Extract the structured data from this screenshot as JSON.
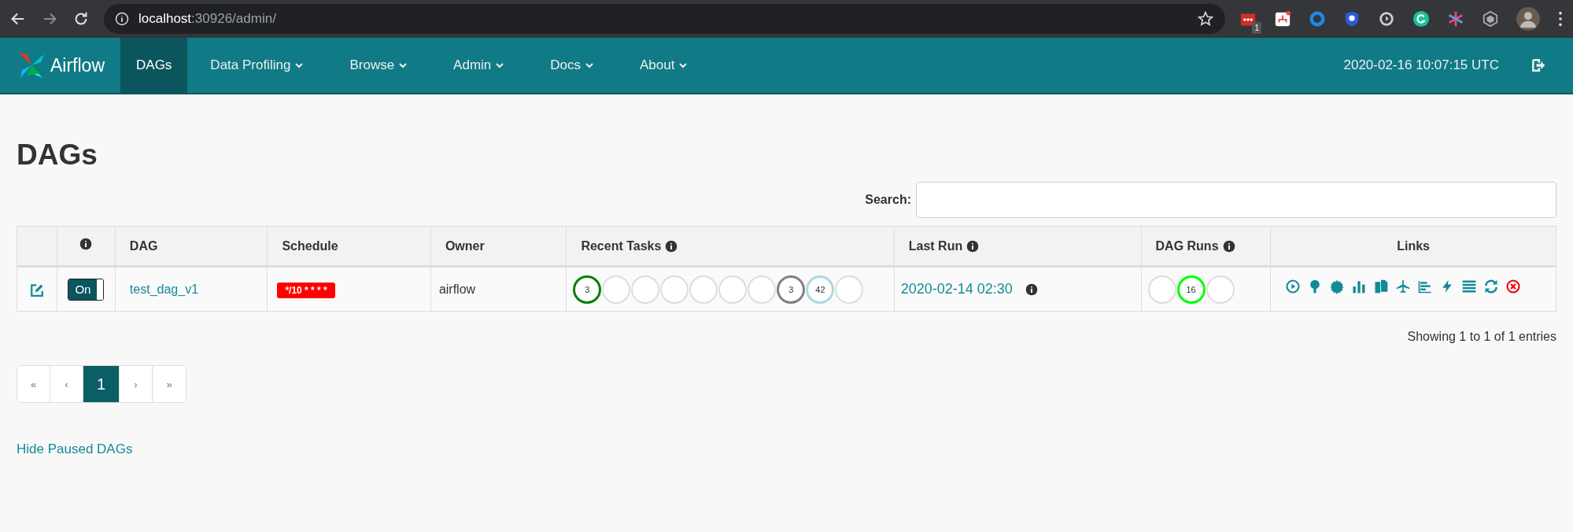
{
  "browser": {
    "url_host": "localhost",
    "url_rest": ":30926/admin/",
    "extension_badge": "1"
  },
  "navbar": {
    "brand": "Airflow",
    "items": [
      {
        "label": "DAGs",
        "selected": true,
        "dropdown": false
      },
      {
        "label": "Data Profiling",
        "selected": false,
        "dropdown": true
      },
      {
        "label": "Browse",
        "selected": false,
        "dropdown": true
      },
      {
        "label": "Admin",
        "selected": false,
        "dropdown": true
      },
      {
        "label": "Docs",
        "selected": false,
        "dropdown": true
      },
      {
        "label": "About",
        "selected": false,
        "dropdown": true
      }
    ],
    "clock": "2020-02-16 10:07:15 UTC"
  },
  "page_title": "DAGs",
  "search": {
    "label": "Search:"
  },
  "table": {
    "columns": [
      {
        "info": false
      },
      {
        "info": true
      },
      {
        "label": "DAG",
        "info": false
      },
      {
        "label": "Schedule",
        "info": false
      },
      {
        "label": "Owner",
        "info": false
      },
      {
        "label": "Recent Tasks",
        "info": true
      },
      {
        "label": "Last Run",
        "info": true
      },
      {
        "label": "DAG Runs",
        "info": true
      },
      {
        "label": "Links",
        "info": false
      }
    ],
    "rows": [
      {
        "toggle": {
          "label": "On",
          "on": true
        },
        "dag": "test_dag_v1",
        "schedule": "*/10 * * * *",
        "owner": "airflow",
        "recent_tasks": [
          {
            "count": "3",
            "color": "#008000"
          },
          {
            "color": "#dddddd"
          },
          {
            "color": "#dddddd"
          },
          {
            "color": "#dddddd"
          },
          {
            "color": "#dddddd"
          },
          {
            "color": "#dddddd"
          },
          {
            "color": "#dddddd"
          },
          {
            "count": "3",
            "color": "#808080"
          },
          {
            "count": "42",
            "color": "#add8e6"
          },
          {
            "color": "#dddddd"
          }
        ],
        "last_run": "2020-02-14 02:30",
        "dag_runs": [
          {
            "color": "#dddddd"
          },
          {
            "count": "16",
            "color": "#00ff00"
          },
          {
            "color": "#dddddd"
          }
        ]
      }
    ]
  },
  "table_info": "Showing 1 to 1 of 1 entries",
  "pagination": [
    {
      "label": "«",
      "selected": false
    },
    {
      "label": "‹",
      "selected": false
    },
    {
      "label": "1",
      "selected": true
    },
    {
      "label": "›",
      "selected": false
    },
    {
      "label": "»",
      "selected": false
    }
  ],
  "footer_link": "Hide Paused DAGs"
}
